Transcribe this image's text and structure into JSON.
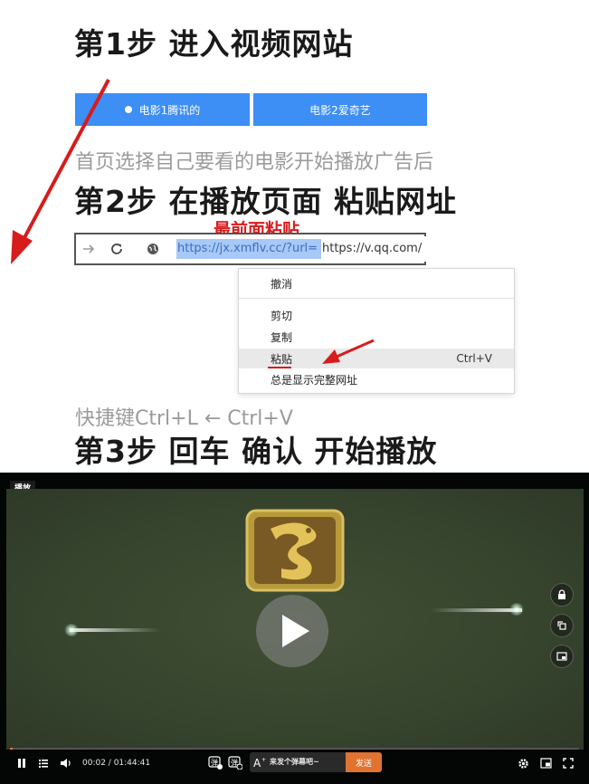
{
  "step1": {
    "title": "第1步  进入视频网站"
  },
  "tabs": [
    {
      "label": "电影1腾讯的"
    },
    {
      "label": "电影2爱奇艺"
    }
  ],
  "instruction": "首页选择自己要看的电影开始播放广告后",
  "step2": {
    "title": "第2步  在播放页面  粘贴网址"
  },
  "annotation": {
    "label": "最前面粘贴"
  },
  "browser": {
    "url_selected": "https://jx.xmflv.cc/?url=",
    "url_rest": "https://v.qq.com/"
  },
  "context_menu": {
    "items": [
      {
        "label": "撤消",
        "shortcut": ""
      },
      {
        "label": "剪切",
        "shortcut": ""
      },
      {
        "label": "复制",
        "shortcut": ""
      },
      {
        "label": "粘贴",
        "shortcut": "Ctrl+V"
      },
      {
        "label": "总是显示完整网址",
        "shortcut": ""
      }
    ]
  },
  "shortcut_hint": "快捷键Ctrl+L  ←  Ctrl+V",
  "step3": {
    "title": "第3步  回车  确认  开始播放"
  },
  "player": {
    "badge": "播放",
    "time": "00:02 / 01:44:41",
    "danmaku_placeholder": "来发个弹幕吧~",
    "send_label": "发送",
    "progress": 0.0003
  },
  "colors": {
    "tab_blue": "#3d8ef5",
    "annotation_red": "#d71c1c",
    "send_orange": "#e0732f",
    "selection_blue": "#a8c8f6"
  },
  "icons": [
    "arrow-right-icon",
    "reload-icon",
    "globe-icon",
    "red-arrow-icon",
    "dragon-logo-icon",
    "play-icon",
    "lock-icon",
    "rotate-icon",
    "pip-icon",
    "pause-icon",
    "playlist-icon",
    "volume-icon",
    "danmaku-on-icon",
    "danmaku-settings-icon",
    "font-style-icon",
    "gear-icon",
    "miniplayer-icon",
    "fullscreen-icon"
  ]
}
